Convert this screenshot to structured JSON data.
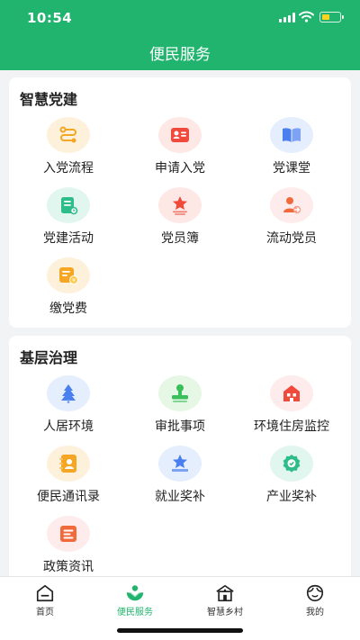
{
  "status_bar": {
    "time": "10:54"
  },
  "header": {
    "title": "便民服务"
  },
  "sections": [
    {
      "title": "智慧党建",
      "items": [
        {
          "label": "入党流程",
          "icon": "flow-icon",
          "color": "#f5a623"
        },
        {
          "label": "申请入党",
          "icon": "id-card-icon",
          "color": "#f04a3c"
        },
        {
          "label": "党课堂",
          "icon": "book-icon",
          "color": "#4a7ff0"
        },
        {
          "label": "党建活动",
          "icon": "clipboard-icon",
          "color": "#2dbd8b"
        },
        {
          "label": "党员簿",
          "icon": "star-ribbon-icon",
          "color": "#f04a3c"
        },
        {
          "label": "流动党员",
          "icon": "user-move-icon",
          "color": "#f06a3c"
        },
        {
          "label": "缴党费",
          "icon": "payment-icon",
          "color": "#f5a623"
        }
      ]
    },
    {
      "title": "基层治理",
      "items": [
        {
          "label": "人居环境",
          "icon": "tree-icon",
          "color": "#4a7ff0"
        },
        {
          "label": "审批事项",
          "icon": "stamp-icon",
          "color": "#3bbf5a"
        },
        {
          "label": "环境住房监控",
          "icon": "house-icon",
          "color": "#f04a3c"
        },
        {
          "label": "便民通讯录",
          "icon": "contacts-icon",
          "color": "#f5a623"
        },
        {
          "label": "就业奖补",
          "icon": "star-award-icon",
          "color": "#4a7ff0"
        },
        {
          "label": "产业奖补",
          "icon": "medal-icon",
          "color": "#2dbd8b"
        },
        {
          "label": "政策资讯",
          "icon": "document-icon",
          "color": "#f06a3c"
        }
      ]
    }
  ],
  "tabbar": {
    "active": 1,
    "tabs": [
      {
        "label": "首页",
        "icon": "home-icon"
      },
      {
        "label": "便民服务",
        "icon": "service-icon"
      },
      {
        "label": "智慧乡村",
        "icon": "village-icon"
      },
      {
        "label": "我的",
        "icon": "profile-icon"
      }
    ]
  },
  "colors": {
    "primary": "#21b46e",
    "text": "#222222",
    "background": "#f2f3f5"
  }
}
